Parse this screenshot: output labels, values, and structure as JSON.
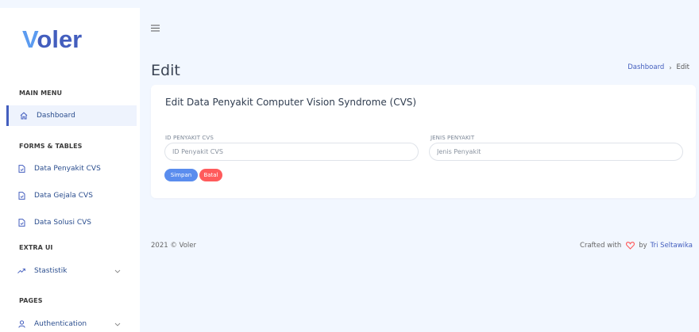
{
  "sidebar": {
    "logo": "Voler",
    "sections": [
      {
        "title": "MAIN MENU",
        "items": [
          {
            "label": "Dashboard",
            "icon": "home-icon",
            "active": true
          }
        ]
      },
      {
        "title": "FORMS & TABLES",
        "items": [
          {
            "label": "Data Penyakit CVS",
            "icon": "document-icon"
          },
          {
            "label": "Data Gejala CVS",
            "icon": "document-icon"
          },
          {
            "label": "Data Solusi CVS",
            "icon": "document-icon"
          }
        ]
      },
      {
        "title": "EXTRA UI",
        "items": [
          {
            "label": "Stastistik",
            "icon": "trending-up-icon",
            "chevron": true
          }
        ]
      },
      {
        "title": "PAGES",
        "items": [
          {
            "label": "Authentication",
            "icon": "user-icon",
            "chevron": true
          }
        ]
      }
    ]
  },
  "header": {
    "menu_icon": "hamburger-icon"
  },
  "page": {
    "title": "Edit",
    "breadcrumb": {
      "link": "Dashboard",
      "separator": "›",
      "current": "Edit"
    }
  },
  "card": {
    "title": "Edit Data Penyakit Computer Vision Syndrome (CVS)",
    "fields": [
      {
        "label": "ID PENYAKIT CVS",
        "placeholder": "ID Penyakit CVS",
        "value": ""
      },
      {
        "label": "JENIS PENYAKIT",
        "placeholder": "Jenis Penyakit",
        "value": ""
      }
    ],
    "buttons": {
      "save": "Simpan",
      "cancel": "Batal"
    }
  },
  "footer": {
    "copyright": "2021 © Voler",
    "crafted_prefix": "Crafted with",
    "crafted_by": "by",
    "author": "Tri Seltawika"
  },
  "colors": {
    "primary": "#435ebe",
    "save": "#5a8dee",
    "cancel": "#ff5b5c",
    "background": "#f2f7ff",
    "heart": "#ff5b5c"
  }
}
